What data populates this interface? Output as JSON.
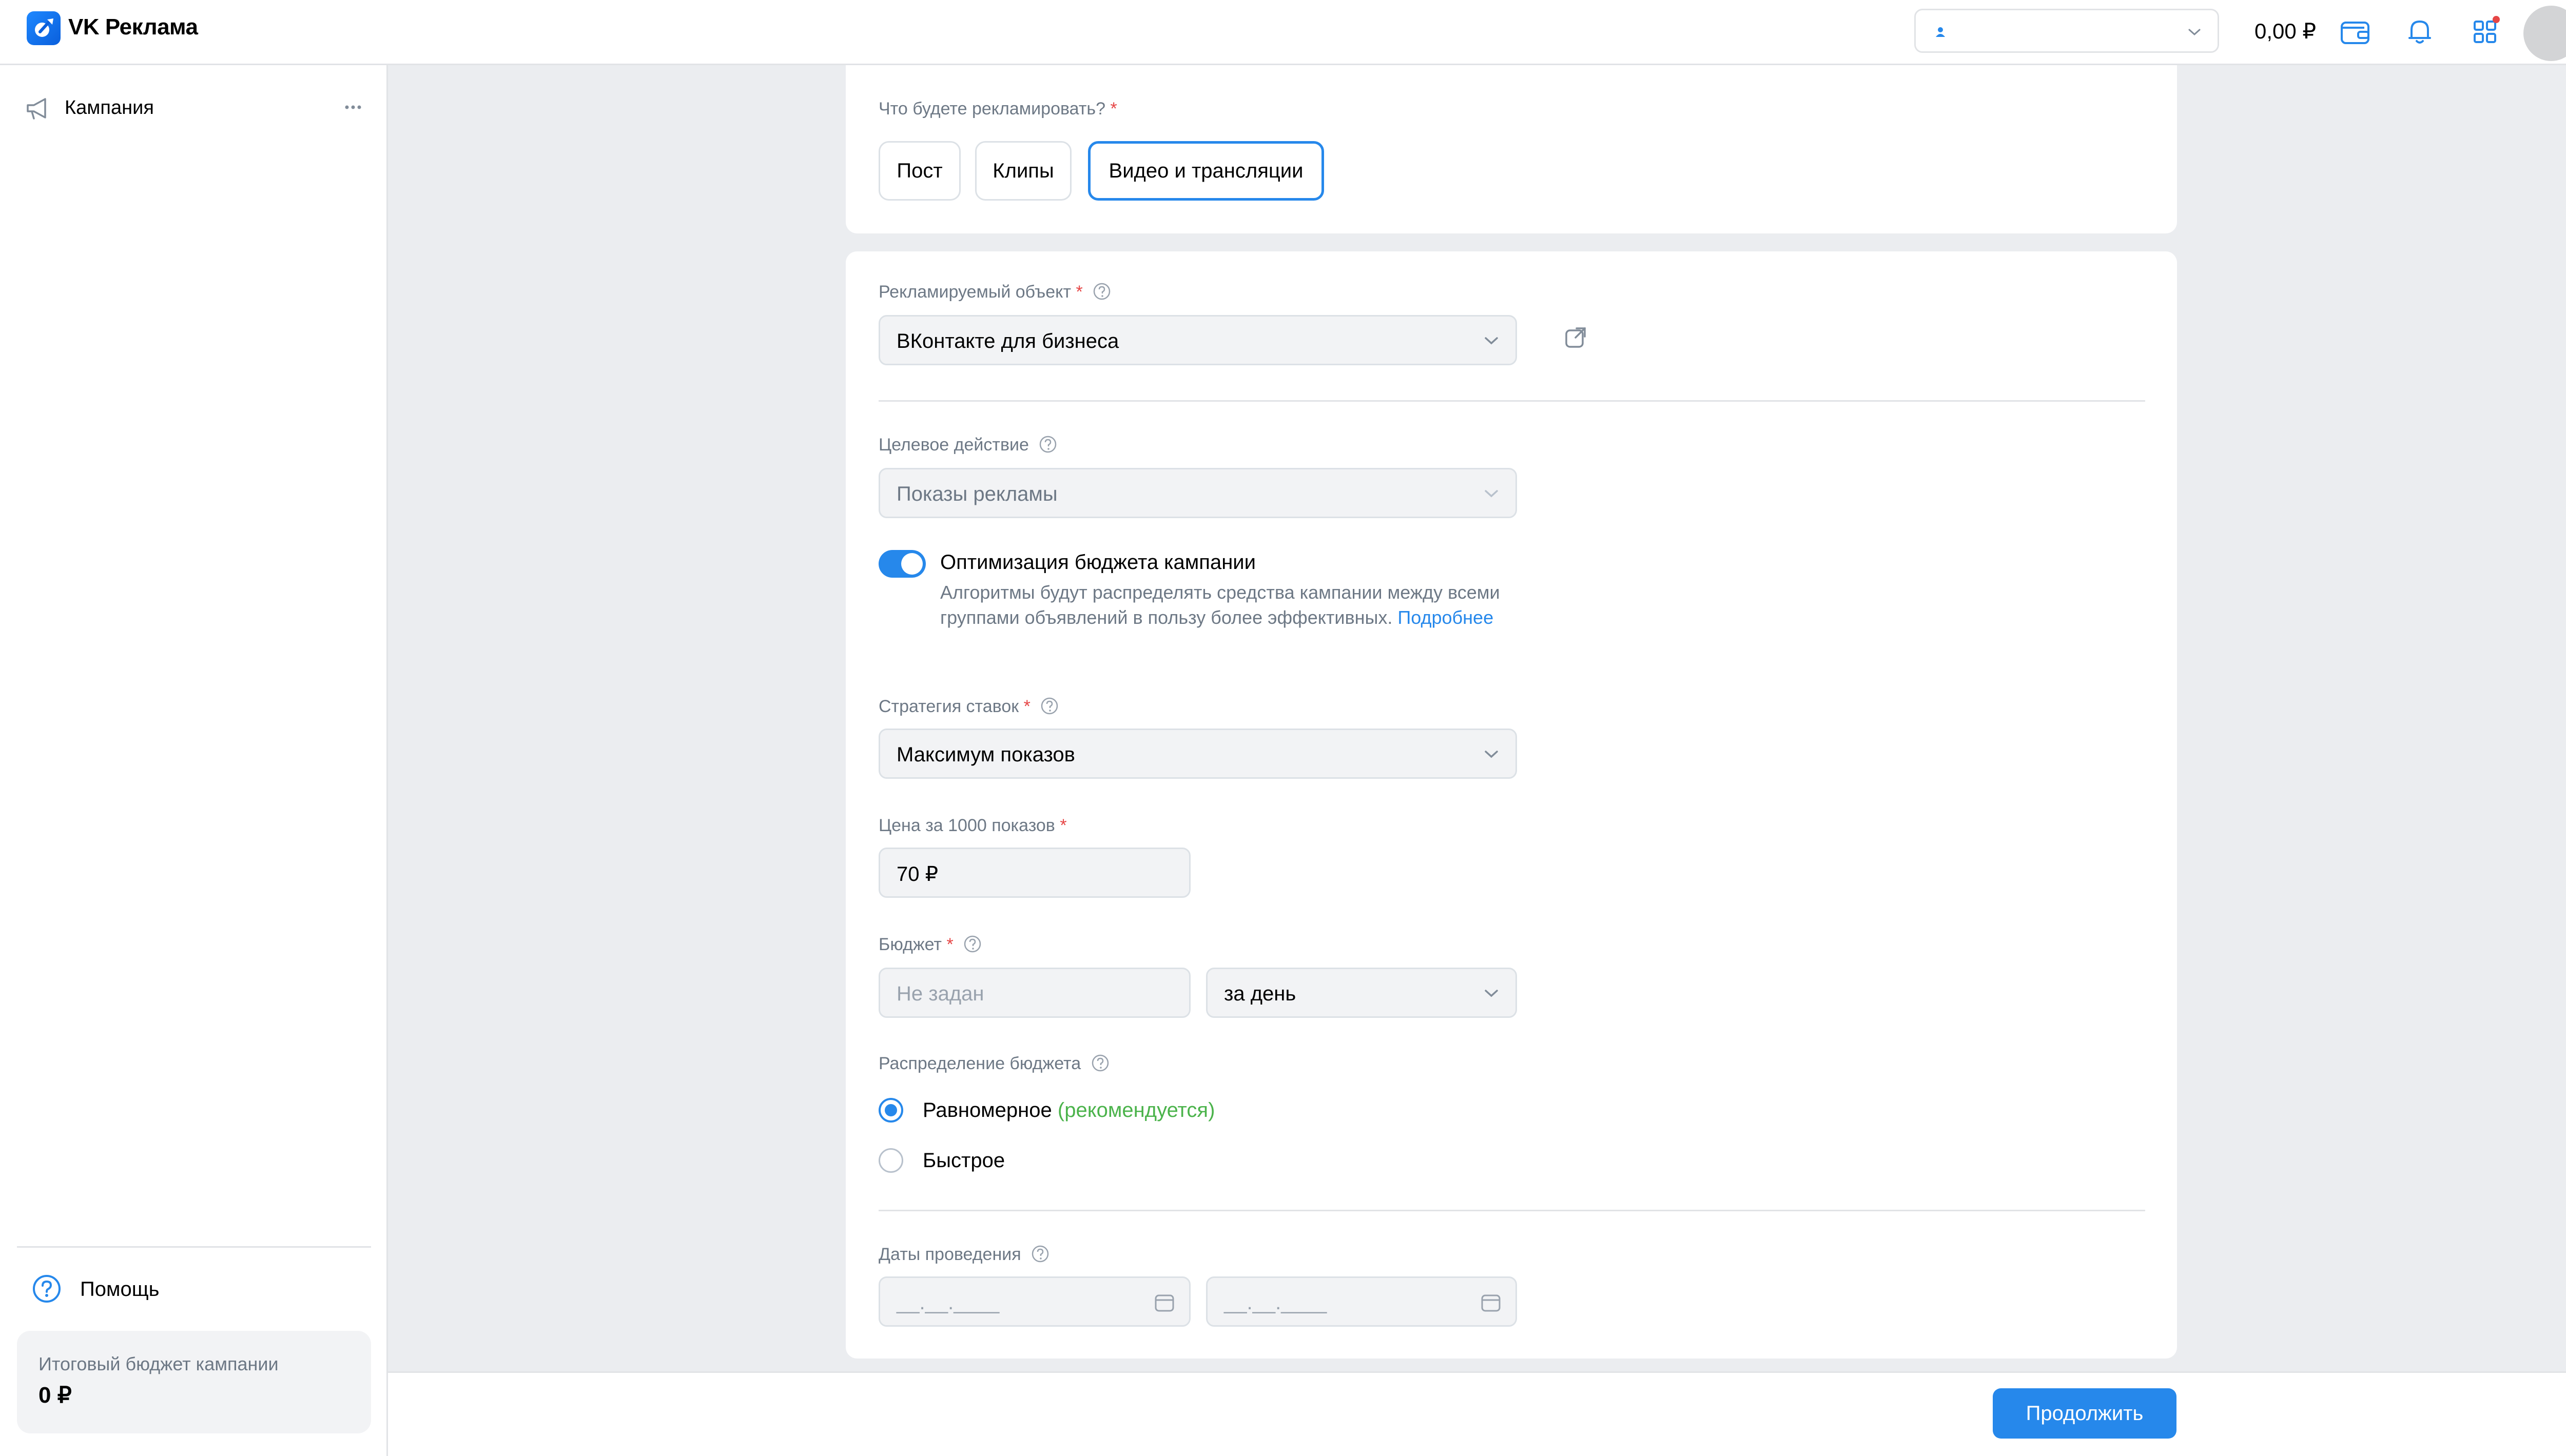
{
  "header": {
    "brand": "VK Реклама",
    "balance": "0,00 ₽"
  },
  "sidebar": {
    "campaign_label": "Кампания",
    "help_label": "Помощь",
    "budget_title": "Итоговый бюджет кампании",
    "budget_value": "0 ₽"
  },
  "form": {
    "what_label": "Что будете рекламировать?",
    "chips": [
      "Пост",
      "Клипы",
      "Видео и трансляции"
    ],
    "object_label": "Рекламируемый объект",
    "object_value": "ВКонтакте для бизнеса",
    "target_label": "Целевое действие",
    "target_value": "Показы рекламы",
    "optimization_title": "Оптимизация бюджета кампании",
    "optimization_desc": "Алгоритмы будут распределять средства кампании между всеми группами объявлений в пользу более эффективных.",
    "optimization_link": "Подробнее",
    "strategy_label": "Стратегия ставок",
    "strategy_value": "Максимум показов",
    "price_label": "Цена за 1000 показов",
    "price_value": "70 ₽",
    "budget_label": "Бюджет",
    "budget_placeholder": "Не задан",
    "budget_period": "за день",
    "distribution_label": "Распределение бюджета",
    "distribution_even": "Равномерное",
    "distribution_recommended": "(рекомендуется)",
    "distribution_fast": "Быстрое",
    "dates_label": "Даты проведения",
    "date_placeholder": "__.__.____",
    "required_mark": "*"
  },
  "footer": {
    "continue_label": "Продолжить"
  },
  "colors": {
    "accent": "#2688eb",
    "required": "#e64646",
    "recommended": "#4bb34b"
  }
}
